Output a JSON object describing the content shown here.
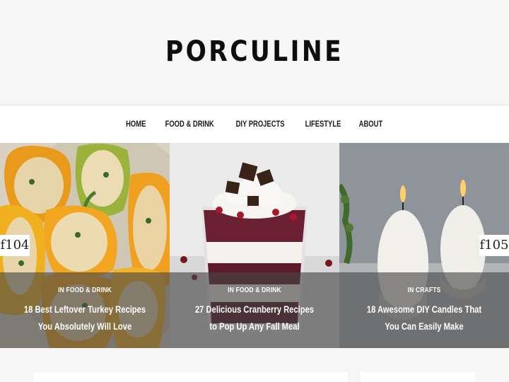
{
  "site": {
    "logo": "PORCULINE"
  },
  "nav": {
    "items": [
      {
        "label": "HOME",
        "name": "nav-home"
      },
      {
        "label": "FOOD & DRINK",
        "name": "nav-food-drink"
      },
      {
        "label": "DIY PROJECTS",
        "name": "nav-diy-projects"
      },
      {
        "label": "LIFESTYLE",
        "name": "nav-lifestyle"
      },
      {
        "label": "ABOUT",
        "name": "nav-about"
      }
    ]
  },
  "cards": [
    {
      "category": "IN FOOD & DRINK",
      "title": "18 Best Leftover Turkey Recipes You Absolutely Will Love",
      "image": "stuffed-peppers-image"
    },
    {
      "category": "IN FOOD & DRINK",
      "title": "27 Delicious Cranberry Recipes to Pop Up Any Fall Meal",
      "image": "cranberry-trifle-image"
    },
    {
      "category": "IN CRAFTS",
      "title": "18 Awesome DIY Candles That You Can Easily Make",
      "image": "egg-candles-image"
    }
  ],
  "badges": {
    "left": "f104",
    "right": "f105"
  },
  "colors": {
    "overlay": "#464646",
    "background": "#f6f6f6",
    "text": "#1a1a1a"
  }
}
